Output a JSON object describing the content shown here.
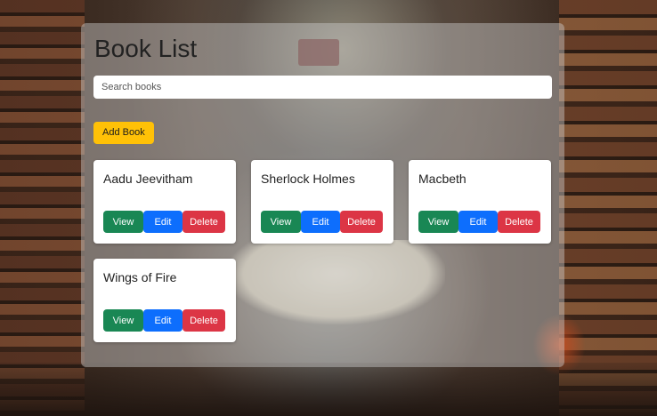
{
  "page": {
    "title": "Book List"
  },
  "search": {
    "placeholder": "Search books",
    "value": ""
  },
  "toolbar": {
    "add_label": "Add Book"
  },
  "books": [
    {
      "title": "Aadu Jeevitham",
      "view_label": "View",
      "edit_label": "Edit",
      "delete_label": "Delete"
    },
    {
      "title": "Sherlock Holmes",
      "view_label": "View",
      "edit_label": "Edit",
      "delete_label": "Delete"
    },
    {
      "title": "Macbeth",
      "view_label": "View",
      "edit_label": "Edit",
      "delete_label": "Delete"
    },
    {
      "title": "Wings of Fire",
      "view_label": "View",
      "edit_label": "Edit",
      "delete_label": "Delete"
    }
  ],
  "colors": {
    "add_button": "#ffc107",
    "view_button": "#198754",
    "edit_button": "#0d6efd",
    "delete_button": "#dc3545",
    "panel_background": "rgba(205,205,205,0.45)"
  }
}
